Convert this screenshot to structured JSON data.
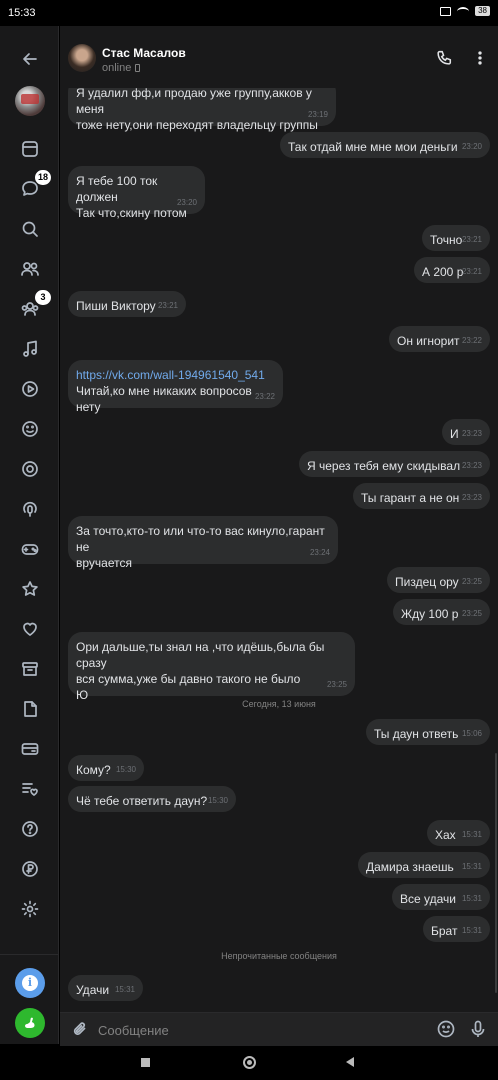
{
  "status_bar": {
    "time": "15:33",
    "battery": "38"
  },
  "rail": {
    "badge_messages": "18",
    "badge_communities": "3"
  },
  "chat": {
    "name": "Стас Масалов",
    "status": "online"
  },
  "messages": [
    {
      "dir": "in",
      "text": "Я удалил фф,и продаю уже группу,акков у меня\nтоже нету,они переходят владельцу группы",
      "time": "23:19"
    },
    {
      "dir": "out",
      "text": "Так отдай мне мне мои деньги",
      "time": "23:20"
    },
    {
      "dir": "in",
      "text": "Я тебе 100 ток должен\nТак что,скину потом",
      "time": "23:20"
    },
    {
      "dir": "out",
      "text": "Точно",
      "time": "23:21"
    },
    {
      "dir": "out",
      "text": "А 200 р",
      "time": "23:21"
    },
    {
      "dir": "in",
      "text": "Пиши Виктору",
      "time": "23:21"
    },
    {
      "dir": "out",
      "text": "Он игнорит",
      "time": "23:22"
    },
    {
      "dir": "in",
      "link": "https://vk.com/wall-194961540_541",
      "text": "Читай,ко мне никаких вопросов нету",
      "time": "23:22"
    },
    {
      "dir": "out",
      "text": "И",
      "time": "23:23"
    },
    {
      "dir": "out",
      "text": "Я через тебя ему скидывал",
      "time": "23:23"
    },
    {
      "dir": "out",
      "text": "Ты гарант а не он",
      "time": "23:23"
    },
    {
      "dir": "in",
      "text": "За точто,кто-то или что-то вас кинуло,гарант не\nвручается",
      "time": "23:24"
    },
    {
      "dir": "out",
      "text": "Пиздец ору",
      "time": "23:25"
    },
    {
      "dir": "out",
      "text": "Жду 100 р",
      "time": "23:25"
    },
    {
      "dir": "in",
      "text": "Ори дальше,ты знал на ,что идёшь,была бы сразу\nвся сумма,уже бы давно такого не было\nЮ",
      "time": "23:25"
    },
    {
      "dir": "out",
      "text": "Ты даун ответь",
      "time": "15:06"
    },
    {
      "dir": "in",
      "text": "Кому?",
      "time": "15:30"
    },
    {
      "dir": "in",
      "text": "Чё тебе ответить даун?",
      "time": "15:30"
    },
    {
      "dir": "out",
      "text": "Хах",
      "time": "15:31"
    },
    {
      "dir": "out",
      "text": "Дамира знаешь",
      "time": "15:31"
    },
    {
      "dir": "out",
      "text": "Все удачи",
      "time": "15:31"
    },
    {
      "dir": "out",
      "text": "Брат",
      "time": "15:31"
    },
    {
      "dir": "in",
      "text": "Удачи",
      "time": "15:31"
    }
  ],
  "separators": {
    "date": "Сегодня, 13 июня",
    "unread": "Непрочитанные сообщения"
  },
  "composer": {
    "placeholder": "Сообщение"
  }
}
